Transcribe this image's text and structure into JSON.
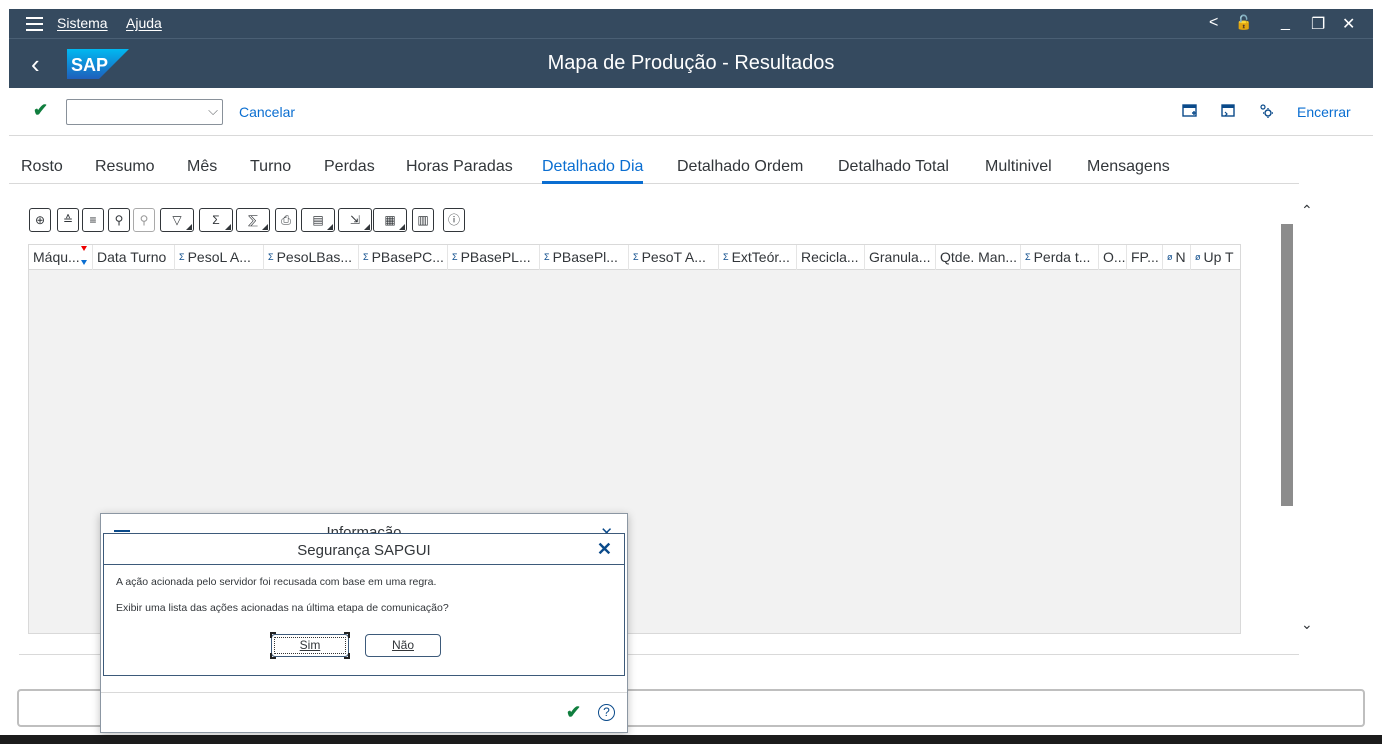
{
  "menu": {
    "sistema": "Sistema",
    "ajuda": "Ajuda"
  },
  "window_controls": {
    "back": "<",
    "lock": "🔓",
    "minimize": "_",
    "restore": "❐",
    "close": "✕"
  },
  "header": {
    "title": "Mapa de Produção - Resultados",
    "logo_text": "SAP"
  },
  "toolbar": {
    "command_field_value": "",
    "cancel_label": "Cancelar",
    "exit_label": "Encerrar"
  },
  "tabs": [
    "Rosto",
    "Resumo",
    "Mês",
    "Turno",
    "Perdas",
    "Horas Paradas",
    "Detalhado Dia",
    "Detalhado Ordem",
    "Detalhado Total",
    "Multinivel",
    "Mensagens"
  ],
  "active_tab": "Detalhado Dia",
  "grid": {
    "columns": [
      {
        "label": "Máqu...",
        "sum": ""
      },
      {
        "label": "Data Turno",
        "sum": ""
      },
      {
        "label": "PesoL A...",
        "sum": "Σ"
      },
      {
        "label": "PesoLBas...",
        "sum": "Σ"
      },
      {
        "label": "PBasePC...",
        "sum": "Σ"
      },
      {
        "label": "PBasePL...",
        "sum": "Σ"
      },
      {
        "label": "PBasePl...",
        "sum": "Σ"
      },
      {
        "label": "PesoT A...",
        "sum": "Σ"
      },
      {
        "label": "ExtTeór...",
        "sum": "Σ"
      },
      {
        "label": "Recicla...",
        "sum": ""
      },
      {
        "label": "Granula...",
        "sum": ""
      },
      {
        "label": "Qtde. Man...",
        "sum": ""
      },
      {
        "label": "Perda t...",
        "sum": "Σ"
      },
      {
        "label": "O...",
        "sum": ""
      },
      {
        "label": "FP...",
        "sum": ""
      },
      {
        "label": "N",
        "sum": "ø"
      },
      {
        "label": "Up T",
        "sum": "ø"
      }
    ],
    "rows": []
  },
  "back_dialog": {
    "title": "Informação"
  },
  "security_dialog": {
    "title": "Segurança SAPGUI",
    "message1": "A ação acionada pelo servidor foi recusada com base em uma regra.",
    "message2": "Exibir uma lista das ações acionadas na última etapa de comunicação?",
    "yes": "Sim",
    "no": "Não"
  },
  "colors": {
    "shell": "#354a5f",
    "link": "#0a6ed1",
    "ok_green": "#107e3e"
  }
}
